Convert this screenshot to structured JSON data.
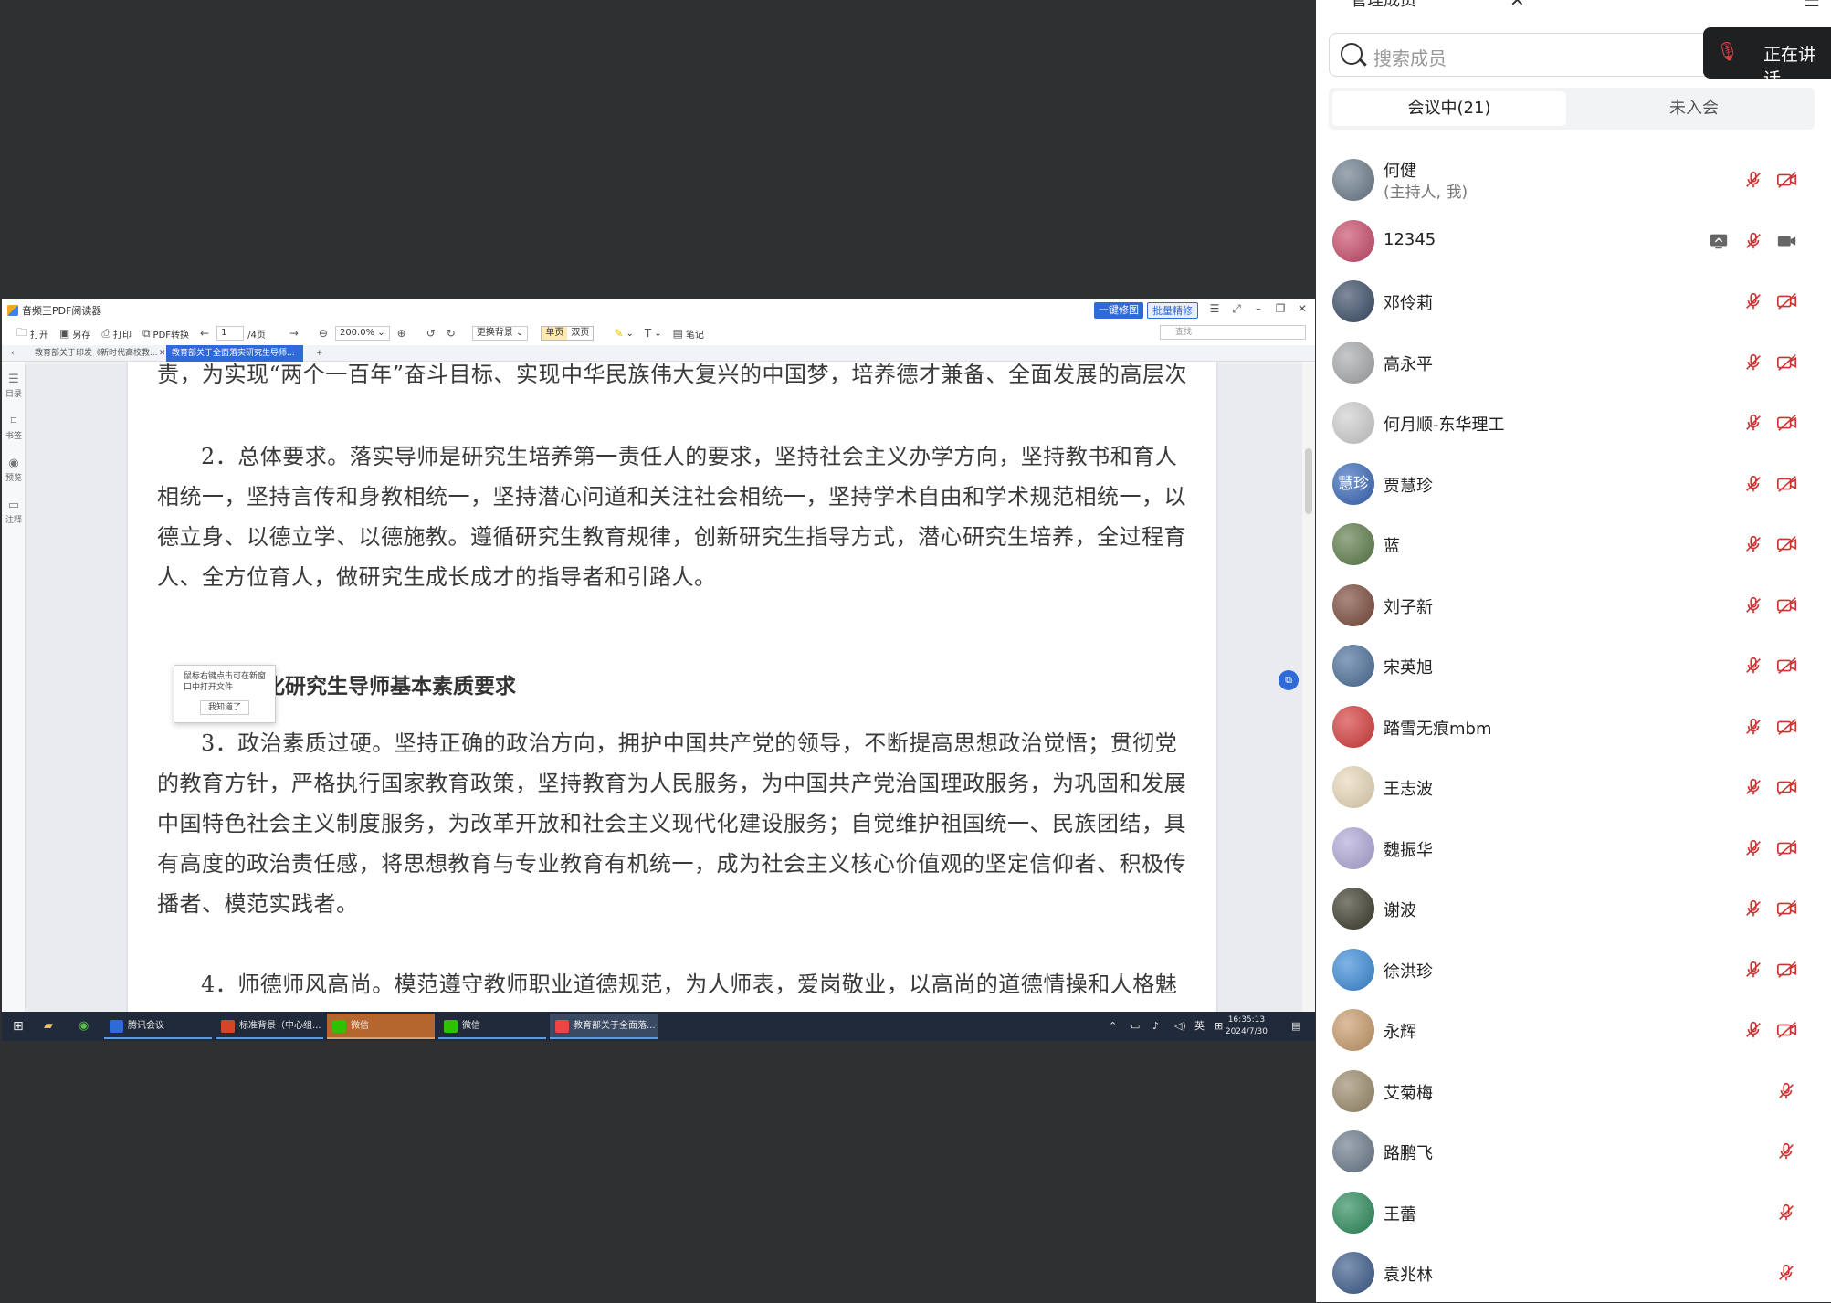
{
  "pdf_app": {
    "title": "音频王PDF阅读器",
    "btn_repair": "一键修图",
    "btn_batch": "批量精修",
    "toolbar": {
      "open": "打开",
      "saveas": "另存",
      "print": "打印",
      "convert": "PDF转换",
      "page_current": "1",
      "page_total": "/4页",
      "zoom": "200.0%",
      "bg": "更换背景",
      "single": "单页",
      "double": "双页",
      "note": "笔记",
      "search_placeholder": "查找"
    },
    "tabs": [
      {
        "label": "教育部关于印发《新时代高校教..."
      },
      {
        "label": "教育部关于全面落实研究生导师..."
      }
    ],
    "rail": [
      {
        "label": "目录"
      },
      {
        "label": "书签"
      },
      {
        "label": "预览"
      },
      {
        "label": "注释"
      }
    ],
    "tooltip": {
      "text": "鼠标右键点击可在新窗口中打开文件",
      "ok": "我知道了"
    },
    "doc": {
      "p0": "责，为实现“两个一百年”奋斗目标、实现中华民族伟大复兴的中国梦，培养德才兼备、全面发展的高层次",
      "p1": "2．总体要求。落实导师是研究生培养第一责任人的要求，坚持社会主义办学方向，坚持教书和育人相统一，坚持言传和身教相统一，坚持潜心问道和关注社会相统一，坚持学术自由和学术规范相统一，以德立身、以德立学、以德施教。遵循研究生教育规律，创新研究生指导方式，潜心研究生培养，全过程育人、全方位育人，做研究生成长成才的指导者和引路人。",
      "h2": "二、强化研究生导师基本素质要求",
      "p3": "3．政治素质过硬。坚持正确的政治方向，拥护中国共产党的领导，不断提高思想政治觉悟；贯彻党的教育方针，严格执行国家教育政策，坚持教育为人民服务，为中国共产党治国理政服务，为巩固和发展中国特色社会主义制度服务，为改革开放和社会主义现代化建设服务；自觉维护祖国统一、民族团结，具有高度的政治责任感，将思想教育与专业教育有机统一，成为社会主义核心价值观的坚定信仰者、积极传播者、模范实践者。",
      "p4": "4．师德师风高尚。模范遵守教师职业道德规范，为人师表，爱岗敬业，以高尚的道德情操和人格魅力"
    }
  },
  "taskbar": {
    "apps": [
      {
        "label": "腾讯会议",
        "color": "#2f6bd8"
      },
      {
        "label": "标准背景（中心组...",
        "color": "#d24726"
      },
      {
        "label": "微信",
        "color": "#2dc100"
      },
      {
        "label": "微信",
        "color": "#2dc100"
      },
      {
        "label": "教育部关于全面落...",
        "color": "#e44"
      }
    ],
    "ime": "英",
    "time": "16:35:13",
    "date": "2024/7/30"
  },
  "panel": {
    "title": "管理成员",
    "search_placeholder": "搜索成员",
    "speaking": "正在讲话",
    "tab_in": "会议中(21)",
    "tab_out": "未入会",
    "members": [
      {
        "name": "何健",
        "sub": "(主持人, 我)",
        "avatar": "#6b7c8a",
        "cam": "off"
      },
      {
        "name": "12345",
        "sub": "",
        "avatar": "#c84a6a",
        "cam": "on",
        "share": true
      },
      {
        "name": "邓伶莉",
        "sub": "",
        "avatar": "#3a4c66",
        "cam": "off"
      },
      {
        "name": "高永平",
        "sub": "",
        "avatar": "#a7a9ab",
        "cam": "off"
      },
      {
        "name": "何月顺-东华理工",
        "sub": "",
        "avatar": "#cfcfcf",
        "cam": "off"
      },
      {
        "name": "贾慧珍",
        "sub": "",
        "avatar": "#3767b8",
        "avatar_text": "慧珍",
        "cam": "off"
      },
      {
        "name": "蓝",
        "sub": "",
        "avatar": "#5d7c4a",
        "cam": "off"
      },
      {
        "name": "刘子新",
        "sub": "",
        "avatar": "#7a4a3a",
        "cam": "off"
      },
      {
        "name": "宋英旭",
        "sub": "",
        "avatar": "#4a6e99",
        "cam": "off"
      },
      {
        "name": "踏雪无痕mbm",
        "sub": "",
        "avatar": "#d63a3a",
        "cam": "off"
      },
      {
        "name": "王志波",
        "sub": "",
        "avatar": "#e8d8b8",
        "cam": "off"
      },
      {
        "name": "魏振华",
        "sub": "",
        "avatar": "#b0a8d8",
        "cam": "off"
      },
      {
        "name": "谢波",
        "sub": "",
        "avatar": "#3a3a2a",
        "cam": "off"
      },
      {
        "name": "徐洪珍",
        "sub": "",
        "avatar": "#3a8ad8",
        "cam": "off"
      },
      {
        "name": "永辉",
        "sub": "",
        "avatar": "#c89a6a",
        "cam": "off"
      },
      {
        "name": "艾菊梅",
        "sub": "",
        "avatar": "#9a8a6a",
        "cam": "none"
      },
      {
        "name": "路鹏飞",
        "sub": "",
        "avatar": "#6a7a8a",
        "cam": "none"
      },
      {
        "name": "王蕾",
        "sub": "",
        "avatar": "#2a8a5a",
        "cam": "none"
      },
      {
        "name": "袁兆林",
        "sub": "",
        "avatar": "#3a5a8a",
        "cam": "none"
      }
    ]
  }
}
